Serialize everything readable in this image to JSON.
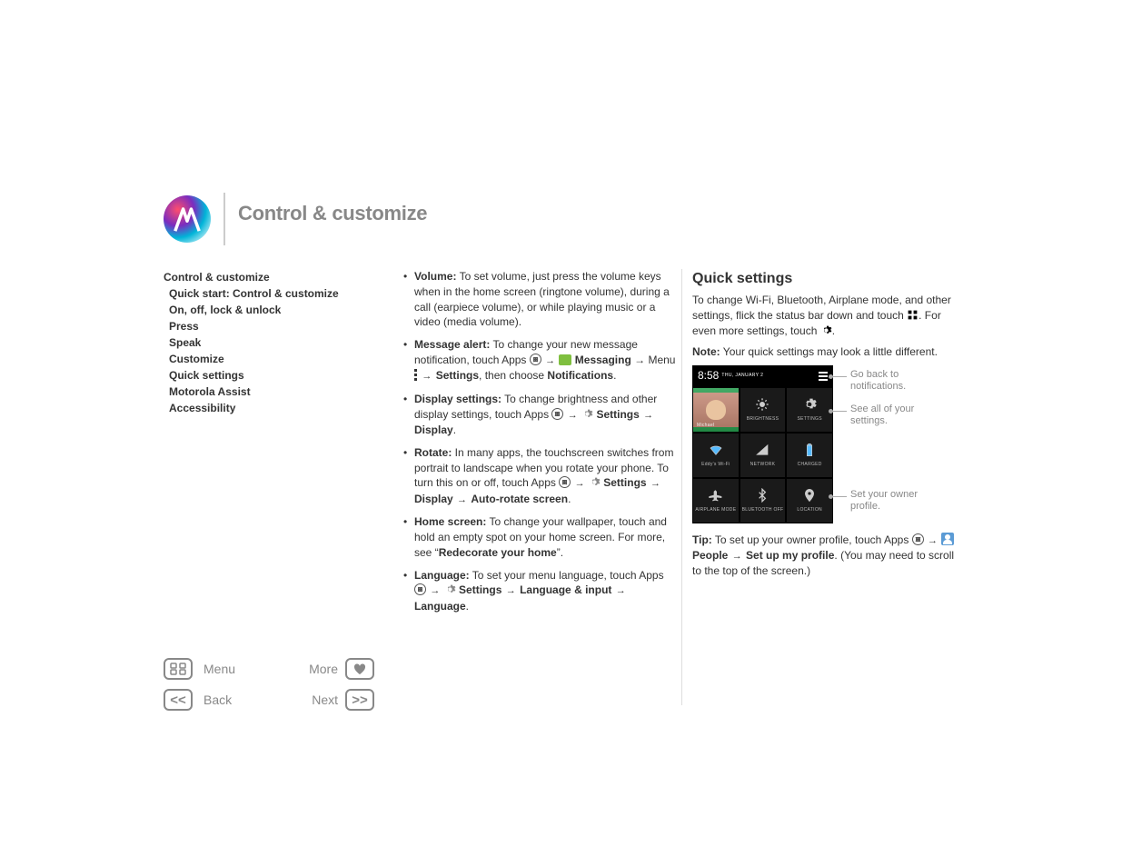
{
  "heading": "Control & customize",
  "sidebar": {
    "h1": "Control & customize",
    "items": [
      "Quick start: Control & customize",
      "On, off, lock & unlock",
      "Press",
      "Speak",
      "Customize",
      "Quick settings",
      "Motorola Assist",
      "Accessibility"
    ]
  },
  "mid": {
    "bullets": [
      {
        "label": "Volume:",
        "text": " To set volume, just press the volume keys when in the home screen (ringtone volume), during a call (earpiece volume), or while playing music or a video (media volume)."
      },
      {
        "label": "Message alert:",
        "text": " To change your new message notification, touch Apps ",
        "path1": "Messaging",
        "mid1": " → Menu ",
        "path2": "Settings",
        "tail": ", then choose ",
        "bold2": "Notifications",
        "after": "."
      },
      {
        "label": "Display settings:",
        "text": " To change brightness and other display settings, touch Apps ",
        "path1": "Settings",
        "path2": "Display",
        "after": "."
      },
      {
        "label": "Rotate:",
        "text": " In many apps, the touchscreen switches from portrait to landscape when you rotate your phone. To turn this on or off, touch Apps ",
        "path1": "Settings",
        "path2": "Display",
        "path3": "Auto-rotate screen",
        "after": "."
      },
      {
        "label": "Home screen:",
        "text": " To change your wallpaper, touch and hold an empty spot on your home screen. For more, see “",
        "bold2": "Redecorate your home",
        "after": "”."
      },
      {
        "label": "Language:",
        "text": " To set your menu language, touch Apps ",
        "path1": "Settings",
        "path2": "Language & input",
        "path3": "Language",
        "after": "."
      }
    ]
  },
  "right": {
    "h2": "Quick settings",
    "p1a": "To change Wi-Fi, Bluetooth, Airplane mode, and other settings, flick the status bar down and touch ",
    "p1b": ". For even more settings, touch ",
    "p1c": ".",
    "note_label": "Note:",
    "note_text": " Your quick settings may look a little different.",
    "callouts": {
      "c1": "Go back to notifications.",
      "c2": "See all of your settings.",
      "c3": "Set your owner profile."
    },
    "tip_label": "Tip:",
    "tip_a": " To set up your owner profile, touch Apps ",
    "tip_people": "People",
    "tip_b": " → ",
    "tip_setup": "Set up my profile",
    "tip_tail": ". (You may need to scroll to the top of the screen.)"
  },
  "qs": {
    "time": "8:58",
    "date": "THU, JANUARY 2",
    "tiles": {
      "owner": "Michael",
      "brightness": "BRIGHTNESS",
      "settings": "SETTINGS",
      "wifi": "Eddy's Wi-Fi",
      "network": "NETWORK",
      "charged": "CHARGED",
      "airplane": "AIRPLANE MODE",
      "bluetooth": "BLUETOOTH OFF",
      "location": "LOCATION"
    }
  },
  "footer": {
    "menu": "Menu",
    "more": "More",
    "back": "Back",
    "next": "Next"
  }
}
